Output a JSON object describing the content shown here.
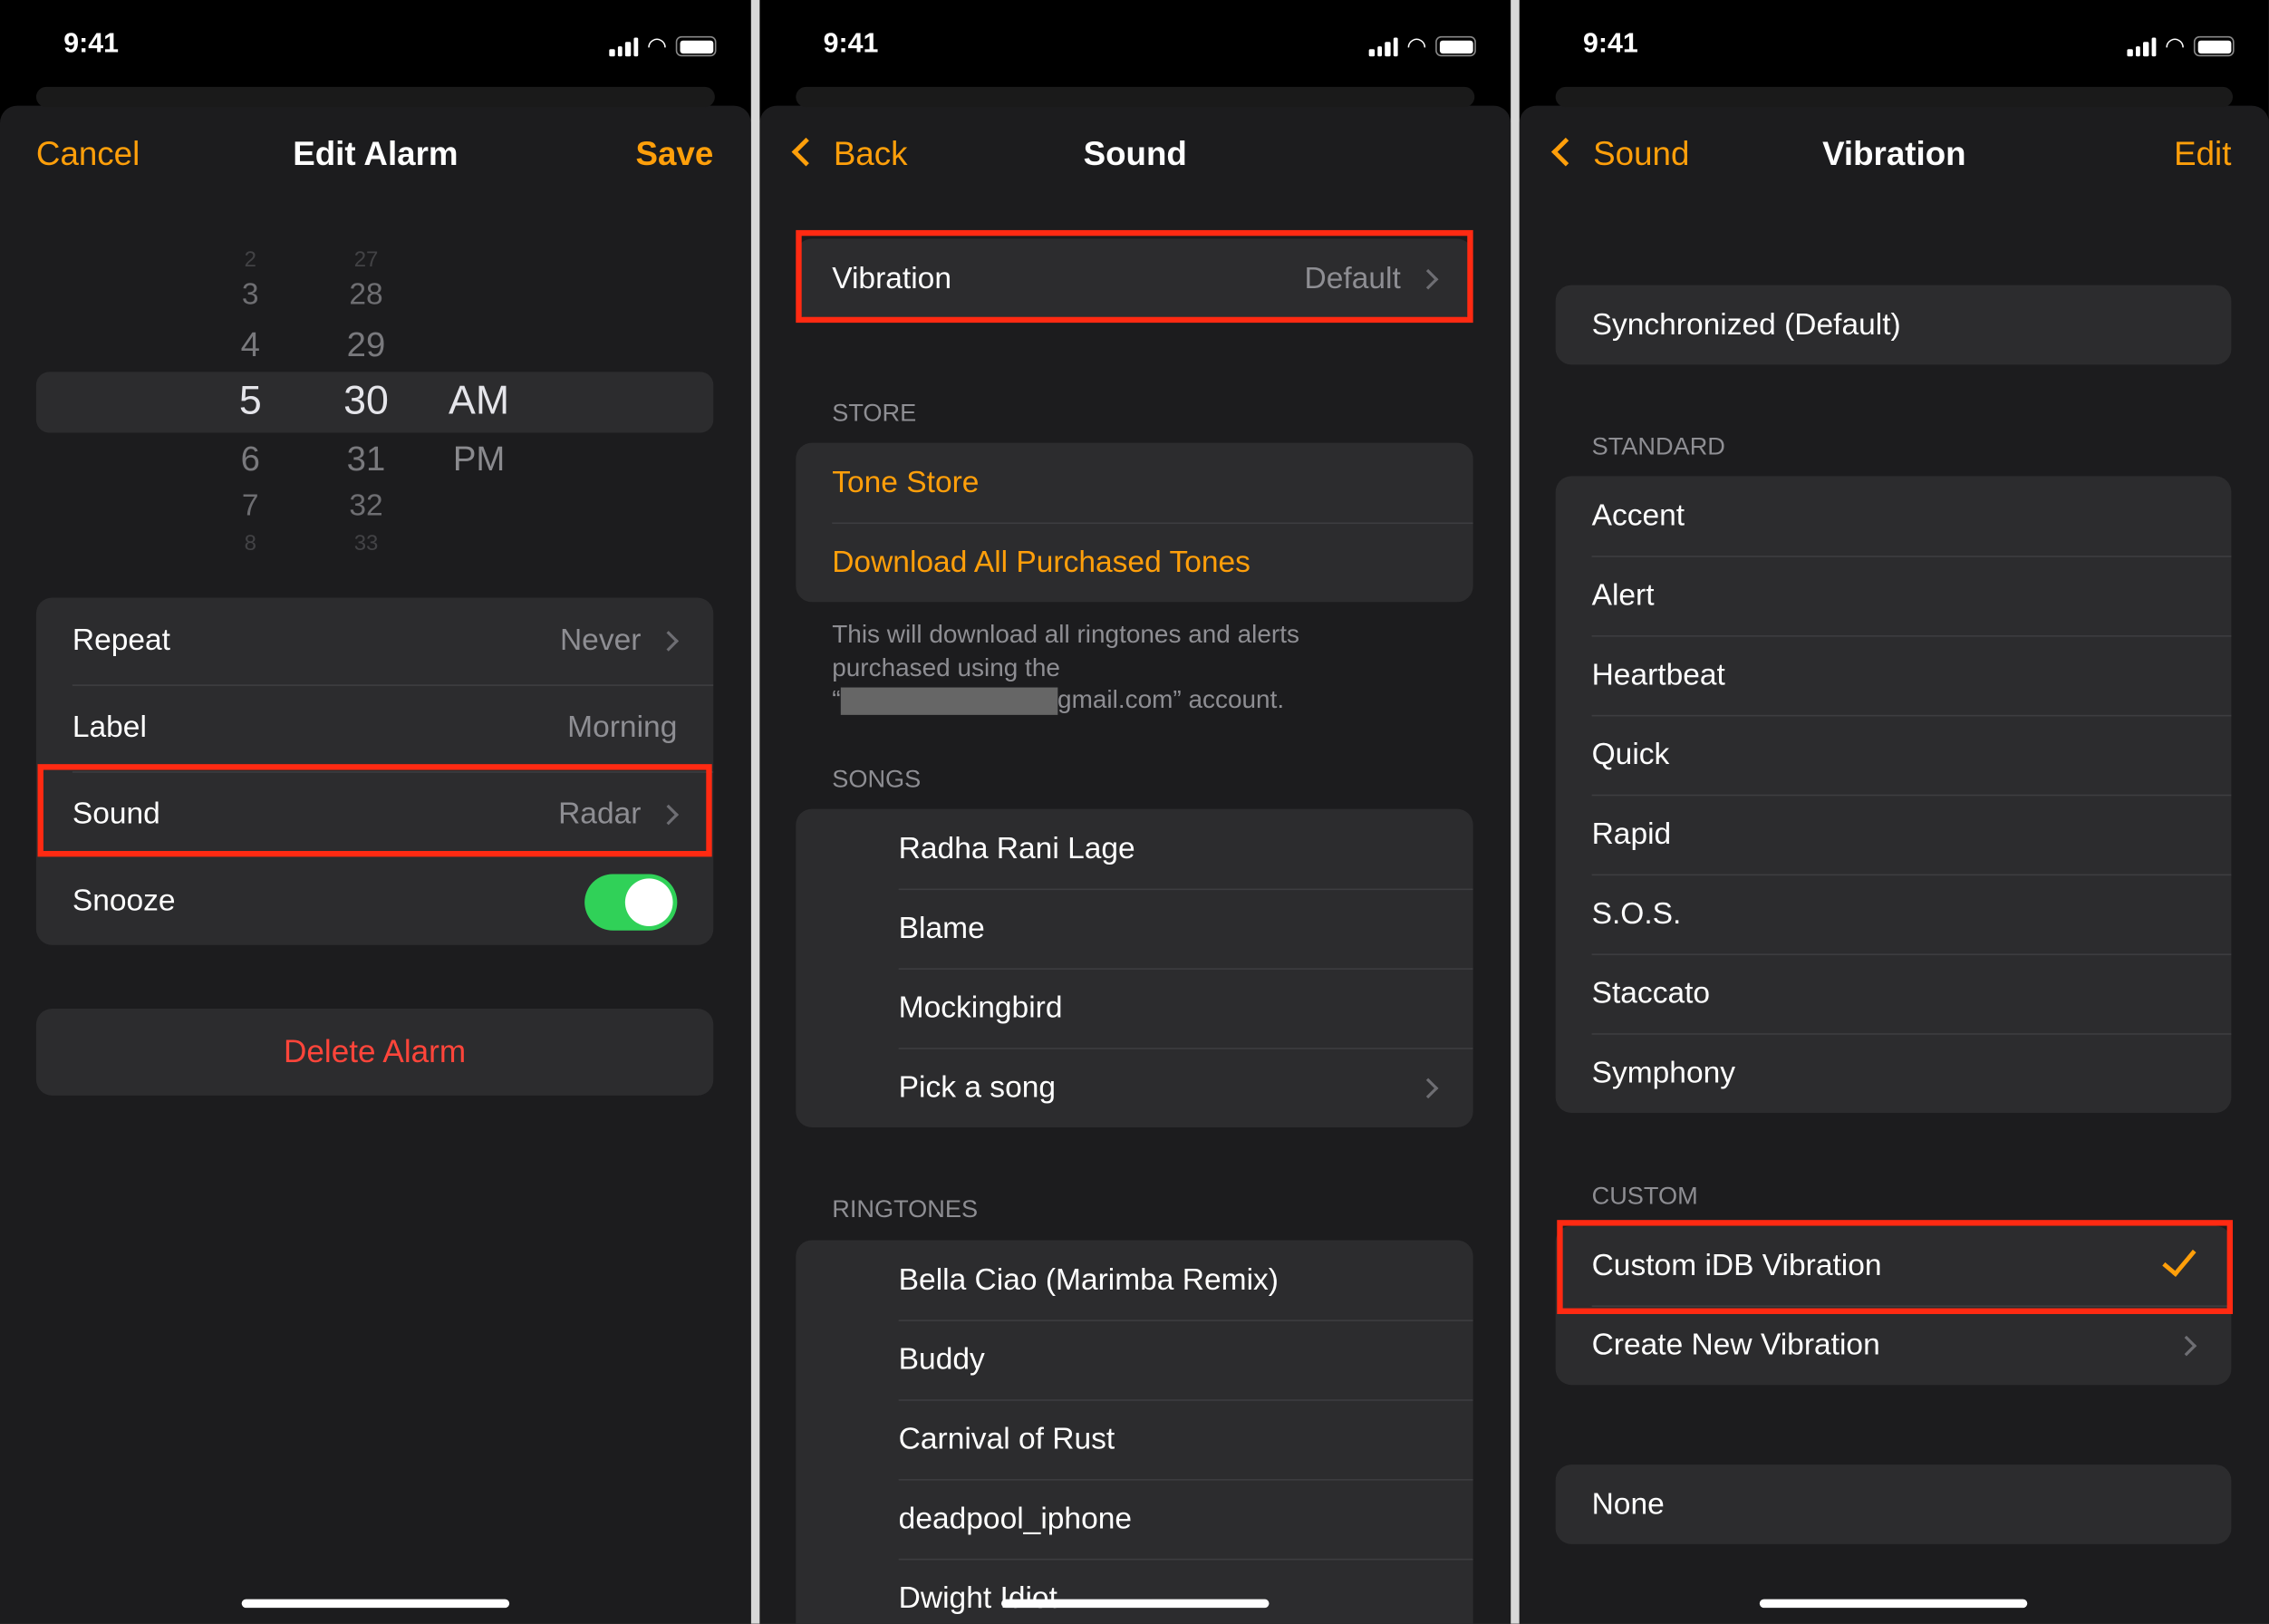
{
  "status": {
    "time": "9:41"
  },
  "colors": {
    "accent": "#ff9f0a",
    "destructive": "#ff453a",
    "highlight_box": "#ff2a12",
    "toggle_on": "#30d158"
  },
  "edit_alarm": {
    "nav": {
      "cancel": "Cancel",
      "title": "Edit Alarm",
      "save": "Save"
    },
    "picker": {
      "hours": [
        "2",
        "3",
        "4",
        "5",
        "6",
        "7",
        "8"
      ],
      "minutes": [
        "27",
        "28",
        "29",
        "30",
        "31",
        "32",
        "33"
      ],
      "periods": [
        "AM",
        "PM"
      ],
      "selected": {
        "hour": "5",
        "minute": "30",
        "period": "AM"
      }
    },
    "rows": [
      {
        "label": "Repeat",
        "value": "Never",
        "chevron": true
      },
      {
        "label": "Label",
        "value": "Morning",
        "chevron": false
      },
      {
        "label": "Sound",
        "value": "Radar",
        "chevron": true,
        "highlighted": true
      }
    ],
    "snooze": {
      "label": "Snooze",
      "on": true
    },
    "delete": "Delete Alarm"
  },
  "sound": {
    "nav": {
      "back": "Back",
      "title": "Sound"
    },
    "vibration": {
      "label": "Vibration",
      "value": "Default"
    },
    "store_header": "STORE",
    "store": [
      "Tone Store",
      "Download All Purchased Tones"
    ],
    "store_footer_1": "This will download all ringtones and alerts",
    "store_footer_2": "purchased using the",
    "store_footer_3": "gmail.com” account.",
    "songs_header": "SONGS",
    "songs": [
      "Radha Rani Lage",
      "Blame",
      "Mockingbird",
      "Pick a song"
    ],
    "ringtones_header": "RINGTONES",
    "ringtones": [
      "Bella Ciao (Marimba Remix)",
      "Buddy",
      "Carnival of Rust",
      "deadpool_iphone",
      "Dwight Idiot"
    ]
  },
  "vibration": {
    "nav": {
      "back": "Sound",
      "title": "Vibration",
      "edit": "Edit"
    },
    "default": "Synchronized (Default)",
    "standard_header": "STANDARD",
    "standard": [
      "Accent",
      "Alert",
      "Heartbeat",
      "Quick",
      "Rapid",
      "S.O.S.",
      "Staccato",
      "Symphony"
    ],
    "custom_header": "CUSTOM",
    "custom": [
      {
        "label": "Custom iDB Vibration",
        "selected": true
      },
      {
        "label": "Create New Vibration",
        "chevron": true
      }
    ],
    "none": "None"
  }
}
